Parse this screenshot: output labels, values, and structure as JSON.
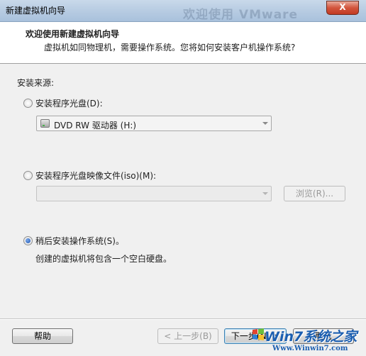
{
  "window": {
    "title": "新建虚拟机向导",
    "background_title": "欢迎使用 VMware",
    "close_label": "X"
  },
  "header": {
    "heading": "欢迎使用新建虚拟机向导",
    "subtitle": "虚拟机如同物理机，需要操作系统。您将如何安装客户机操作系统?"
  },
  "source": {
    "label": "安装来源:",
    "disc_option": {
      "label": "安装程序光盘(D):",
      "checked": false
    },
    "disc_drive": {
      "value": "DVD RW 驱动器 (H:)"
    },
    "iso_option": {
      "label": "安装程序光盘映像文件(iso)(M):",
      "checked": false
    },
    "iso_path": {
      "value": ""
    },
    "browse_label": "浏览(R)...",
    "later_option": {
      "label": "稍后安装操作系统(S)。",
      "checked": true
    },
    "later_note": "创建的虚拟机将包含一个空白硬盘。"
  },
  "footer": {
    "help_label": "帮助",
    "back_label": "< 上一步(B)",
    "next_label": "下一步(N) >",
    "cancel_label": "取消"
  },
  "watermark": {
    "brand": "Win7系统之家",
    "url": "Www.Winwin7.com"
  },
  "colors": {
    "accent": "#1f56b5",
    "titlebar": "#b9cde3",
    "close": "#c23a22",
    "watermark": "#1b5eb0"
  }
}
